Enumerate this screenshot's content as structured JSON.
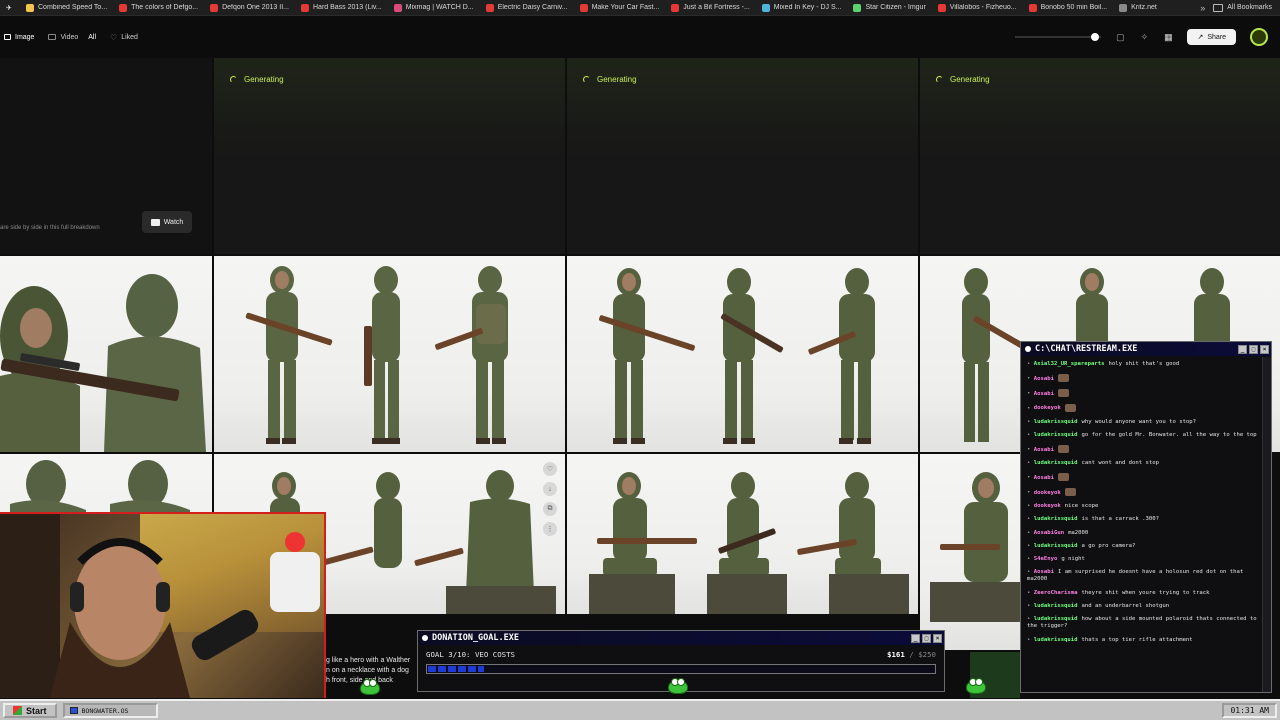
{
  "bookmarks": {
    "items": [
      {
        "label": "Combined Speed To...",
        "color": "#f3c34e"
      },
      {
        "label": "The colors of Defgo...",
        "color": "#e53935"
      },
      {
        "label": "Defqon One 2013 II...",
        "color": "#e53935"
      },
      {
        "label": "Hard Bass 2013 (Liv...",
        "color": "#e53935"
      },
      {
        "label": "Mixmag | WATCH D...",
        "color": "#d94a7a"
      },
      {
        "label": "Electric Daisy Carniv...",
        "color": "#e53935"
      },
      {
        "label": "Make Your Car Fast...",
        "color": "#e53935"
      },
      {
        "label": "Just a Bit Fortress -...",
        "color": "#e53935"
      },
      {
        "label": "Mixed In Key - DJ S...",
        "color": "#4fb3d9"
      },
      {
        "label": "Star Citizen - Imgur",
        "color": "#5bd26b"
      },
      {
        "label": "Villalobos - Fizheuo...",
        "color": "#e53935"
      },
      {
        "label": "Bonobo 50 min Boil...",
        "color": "#e53935"
      },
      {
        "label": "Kritz.net",
        "color": "#8a8a8a"
      }
    ],
    "more": "»",
    "all_label": "All Bookmarks"
  },
  "toolbar": {
    "tabs": [
      {
        "label": "Image",
        "icon": "image-icon"
      },
      {
        "label": "Video",
        "icon": "video-icon"
      },
      {
        "label": "All",
        "icon": ""
      },
      {
        "label": "Liked",
        "icon": "heart-icon"
      }
    ],
    "share_label": "Share",
    "accent": "#c9f04f"
  },
  "grid": {
    "generating_label": "Generating",
    "watch_label": "Watch",
    "breakdown_text": "are side by side in this full breakdown"
  },
  "chat": {
    "title": "C:\\CHAT\\RESTREAM.EXE",
    "messages": [
      {
        "user": "Axial32_UR_spareparts",
        "text": "holy shit that's good",
        "emote": false
      },
      {
        "user": "Aosabi",
        "text": "",
        "emote": true
      },
      {
        "user": "Aosabi",
        "text": "",
        "emote": true
      },
      {
        "user": "dookeyok",
        "text": "",
        "emote": true
      },
      {
        "user": "ludakrissquid",
        "text": "why would anyone want you to stop?",
        "emote": false
      },
      {
        "user": "ludakrissquid",
        "text": "go for the gold Mr. Bonwater. all the way to the top",
        "emote": false
      },
      {
        "user": "Aosabi",
        "text": "",
        "emote": true
      },
      {
        "user": "ludakrissquid",
        "text": "cant wont and dont stop",
        "emote": false
      },
      {
        "user": "Aosabi",
        "text": "",
        "emote": true
      },
      {
        "user": "dookeyok",
        "text": "",
        "emote": true
      },
      {
        "user": "dookeyok",
        "text": "nice scope",
        "emote": false
      },
      {
        "user": "ludakrissquid",
        "text": "is that a carrack .300?",
        "emote": false
      },
      {
        "user": "AosabiGun",
        "text": "ma2000",
        "emote": false
      },
      {
        "user": "ludakrissquid",
        "text": "a go pro camera?",
        "emote": false
      },
      {
        "user": "S4eEnyo",
        "text": "g night",
        "emote": false
      },
      {
        "user": "Aosabi",
        "text": "I am surprised he doesnt have a holosun red dot on that ma2000",
        "emote": false
      },
      {
        "user": "ZeeroCharisma",
        "text": "theyre shit when youre trying to track",
        "emote": false
      },
      {
        "user": "ludakrissquid",
        "text": "and an underbarrel shotgun",
        "emote": false
      },
      {
        "user": "ludakrissquid",
        "text": "how about a side mounted polaroid thats connected to the trigger?",
        "emote": false
      },
      {
        "user": "ludakrissquid",
        "text": "thats a top tier rifle attachment",
        "emote": false
      }
    ]
  },
  "donation": {
    "title": "DONATION_GOAL.EXE",
    "goal_label": "GOAL 3/10: VEO COSTS",
    "amount": "$161",
    "target": "/ $250",
    "progress_fraction": 0.644
  },
  "overlay": {
    "line1": "g like a hero with a Walther",
    "line2": "n on a necklace with a dog",
    "line3": "h front, side and back"
  },
  "taskbar": {
    "start_label": "Start",
    "task_label": "BONGWATER.OS",
    "clock": "01:31 AM"
  }
}
